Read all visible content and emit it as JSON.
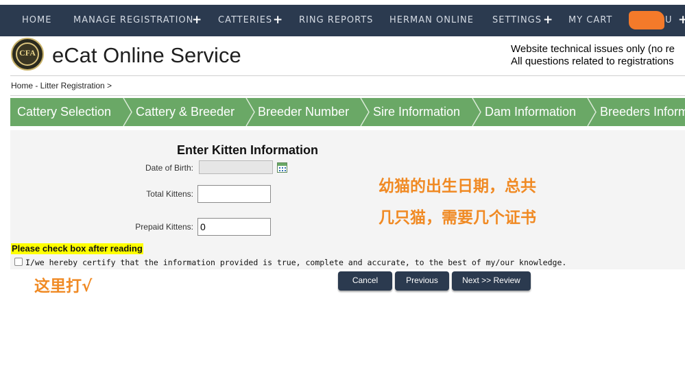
{
  "nav": {
    "items": [
      "HOME",
      "MANAGE REGISTRATION",
      "CATTERIES",
      "RING REPORTS",
      "HERMAN ONLINE",
      "SETTINGS",
      "MY CART"
    ],
    "plus": "+",
    "user_suffix": "U",
    "trailing_plus": "+",
    "bg_color": "#2b3a4f"
  },
  "header": {
    "logo_text": "CFA",
    "title": "eCat Online Service",
    "notice_line1": "Website technical issues only (no re",
    "notice_line2": "All questions related to registrations"
  },
  "breadcrumb": "Home - Litter Registration >",
  "steps": {
    "color": "#6aa866",
    "items": [
      "Cattery Selection",
      "Cattery & Breeder",
      "Breeder Number",
      "Sire Information",
      "Dam Information",
      "Breeders Inform"
    ]
  },
  "form": {
    "title": "Enter Kitten Information",
    "dob_label": "Date of Birth:",
    "dob_value": "",
    "total_label": "Total Kittens:",
    "total_value": "",
    "prepaid_label": "Prepaid Kittens:",
    "prepaid_value": "0",
    "check_note": "Please check box after reading",
    "agree_text": "I/we hereby certify that the information provided is true, complete and accurate, to the best of my/our knowledge.",
    "agree_checked": false
  },
  "buttons": {
    "cancel": "Cancel",
    "previous": "Previous",
    "next": "Next >> Review"
  },
  "annotations": {
    "main": "幼猫的出生日期，总共几只猫，需要几个证书",
    "check": "这里打√",
    "color": "#f08a24"
  }
}
